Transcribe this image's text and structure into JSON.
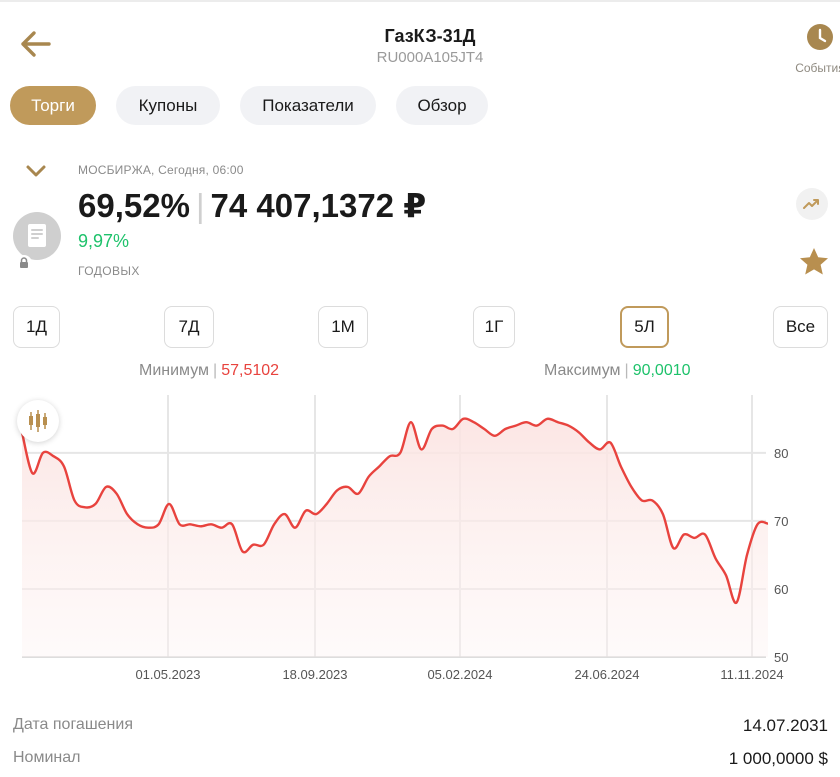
{
  "header": {
    "title": "ГазКЗ-31Д",
    "isin": "RU000A105JT4",
    "events_label": "События"
  },
  "tabs": [
    {
      "label": "Торги",
      "active": true
    },
    {
      "label": "Купоны",
      "active": false
    },
    {
      "label": "Показатели",
      "active": false
    },
    {
      "label": "Обзор",
      "active": false
    }
  ],
  "quote": {
    "exchange_line": "МОСБИРЖА, Сегодня, 06:00",
    "price_percent": "69,52%",
    "price_money": "74 407,1372 ₽",
    "yield": "9,97%",
    "yield_note": "ГОДОВЫХ"
  },
  "periods": [
    {
      "label": "1Д",
      "active": false
    },
    {
      "label": "7Д",
      "active": false
    },
    {
      "label": "1М",
      "active": false
    },
    {
      "label": "1Г",
      "active": false
    },
    {
      "label": "5Л",
      "active": true
    },
    {
      "label": "Все",
      "active": false
    }
  ],
  "stats": {
    "min_label": "Минимум",
    "min_value": "57,5102",
    "max_label": "Максимум",
    "max_value": "90,0010"
  },
  "chart_data": {
    "type": "area",
    "x_tick_labels": [
      "01.05.2023",
      "18.09.2023",
      "05.02.2024",
      "24.06.2024",
      "11.11.2024"
    ],
    "y_ticks": [
      50,
      60,
      70,
      80
    ],
    "ylim": [
      50,
      88.5
    ],
    "line_color": "#e8433e",
    "values": [
      83,
      77,
      80,
      79.5,
      78,
      73,
      72,
      72.5,
      75,
      74,
      71,
      69.5,
      69,
      69.5,
      72.5,
      69.5,
      69.5,
      69.2,
      69.5,
      69,
      69.5,
      65.5,
      66.5,
      66.5,
      69.5,
      71,
      69,
      71.5,
      71,
      72.5,
      74.5,
      75,
      74,
      76.5,
      78,
      79.5,
      80,
      84.5,
      80.5,
      83.5,
      84,
      83.5,
      85,
      84.5,
      83.5,
      82.5,
      83.5,
      84,
      84.5,
      84,
      85,
      84.5,
      84,
      83,
      81.5,
      80.5,
      81.5,
      78,
      75,
      73,
      73,
      71,
      66,
      68,
      67.5,
      68,
      64.5,
      62,
      58,
      65,
      69.5,
      69.6
    ]
  },
  "details": [
    {
      "label": "Дата погашения",
      "value": "14.07.2031"
    },
    {
      "label": "Номинал",
      "value": "1 000,0000 $"
    }
  ]
}
